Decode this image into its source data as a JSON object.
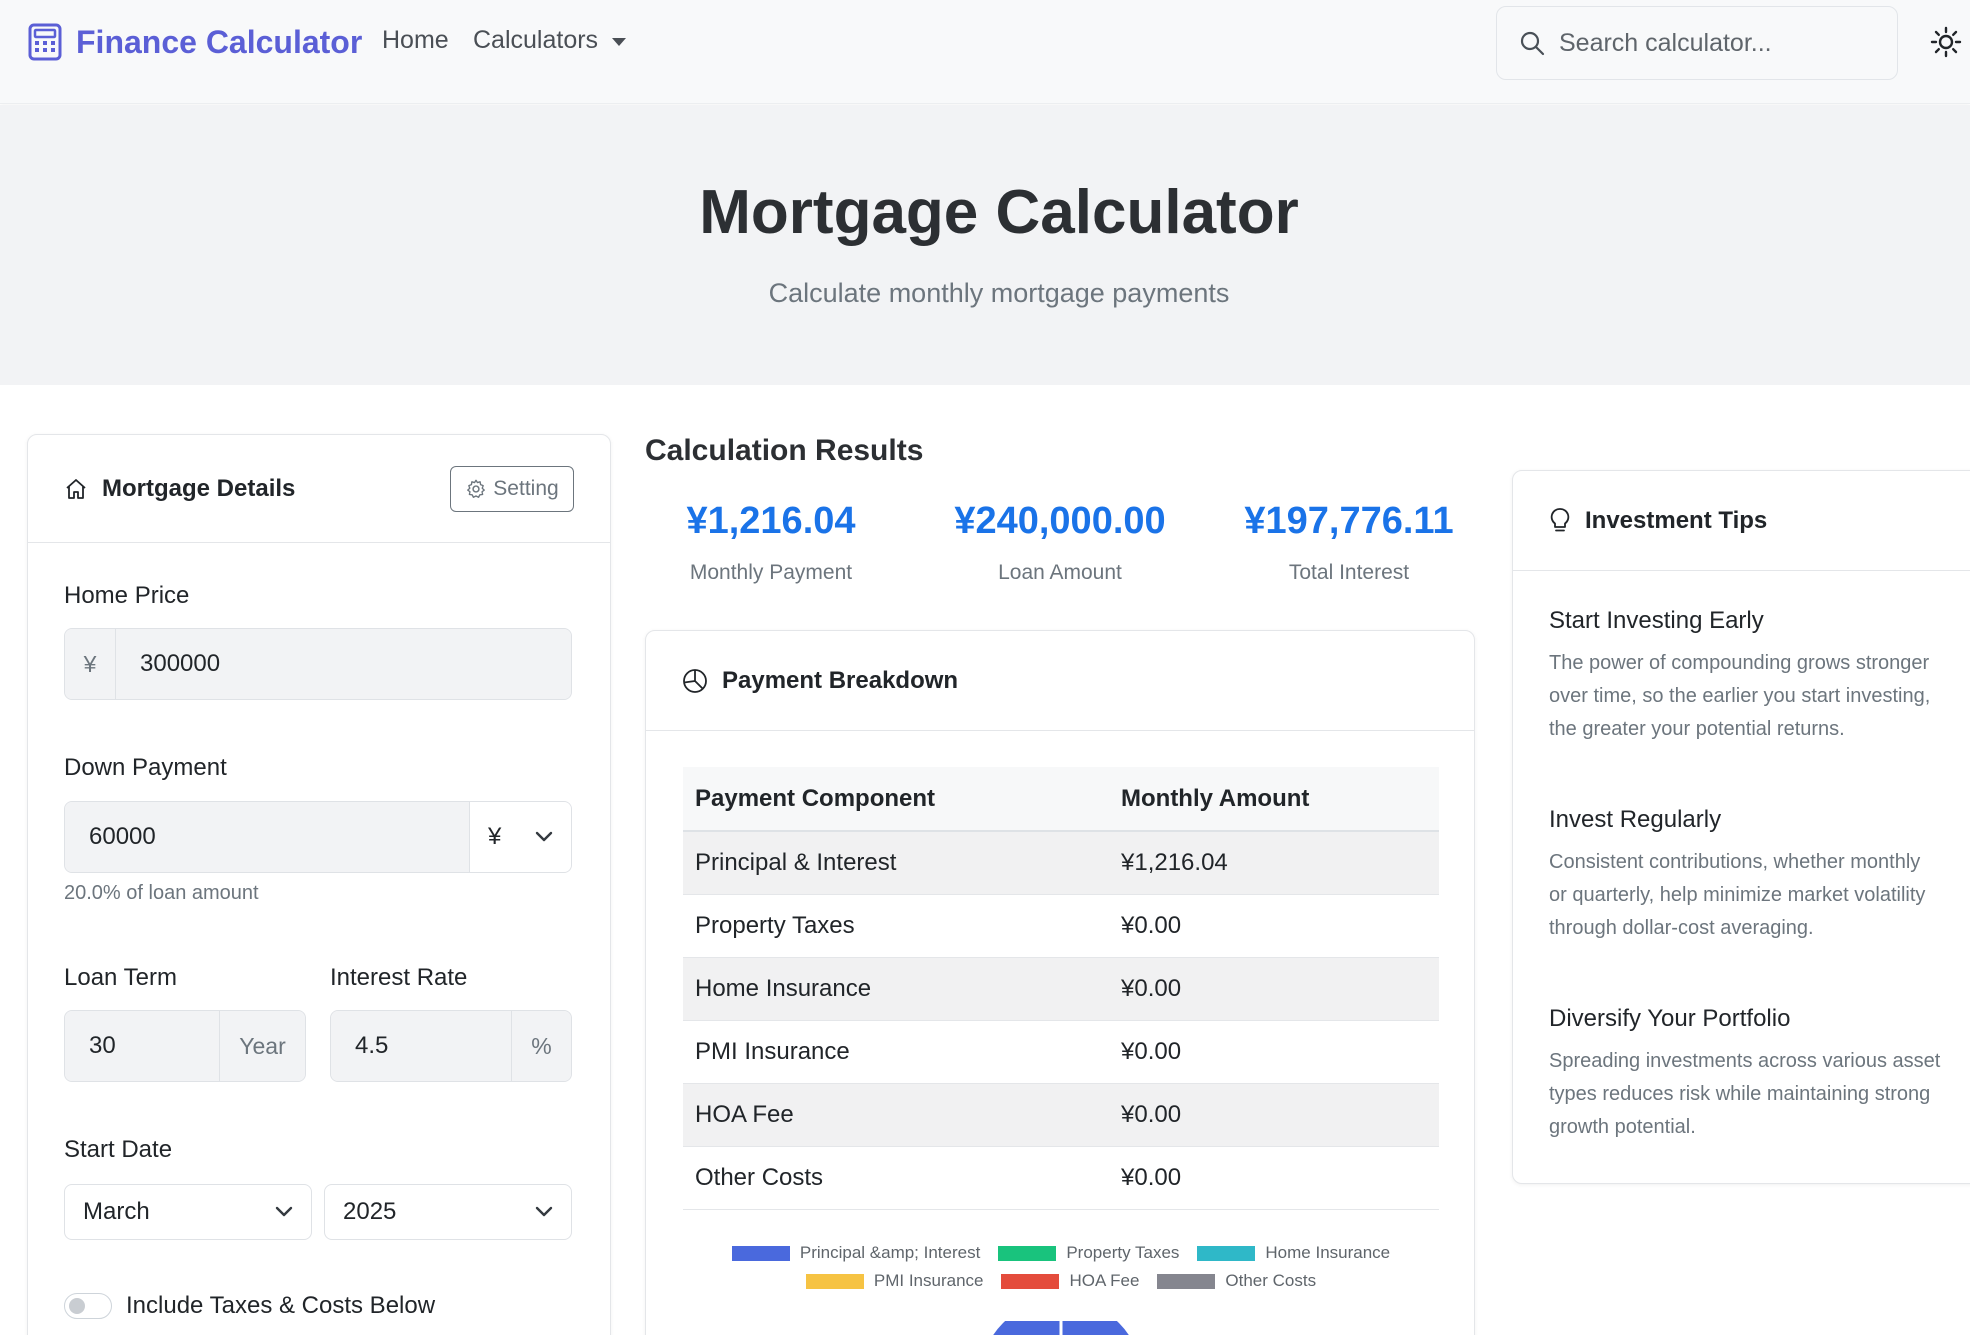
{
  "navbar": {
    "brand": "Finance Calculator",
    "home": "Home",
    "calculators": "Calculators",
    "search_placeholder": "Search calculator..."
  },
  "hero": {
    "title": "Mortgage Calculator",
    "subtitle": "Calculate monthly mortgage payments"
  },
  "details": {
    "title": "Mortgage Details",
    "setting_label": "Setting",
    "home_price": {
      "label": "Home Price",
      "currency": "¥",
      "value": "300000"
    },
    "down_payment": {
      "label": "Down Payment",
      "value": "60000",
      "unit": "¥",
      "helper": "20.0% of loan amount"
    },
    "loan_term": {
      "label": "Loan Term",
      "value": "30",
      "unit": "Year"
    },
    "interest_rate": {
      "label": "Interest Rate",
      "value": "4.5",
      "unit": "%"
    },
    "start_date": {
      "label": "Start Date",
      "month": "March",
      "year": "2025"
    },
    "include_taxes_label": "Include Taxes & Costs Below"
  },
  "results": {
    "title": "Calculation Results",
    "metrics": [
      {
        "value": "¥1,216.04",
        "label": "Monthly Payment"
      },
      {
        "value": "¥240,000.00",
        "label": "Loan Amount"
      },
      {
        "value": "¥197,776.11",
        "label": "Total Interest"
      }
    ]
  },
  "breakdown": {
    "title": "Payment Breakdown",
    "headers": [
      "Payment Component",
      "Monthly Amount"
    ],
    "rows": [
      [
        "Principal & Interest",
        "¥1,216.04"
      ],
      [
        "Property Taxes",
        "¥0.00"
      ],
      [
        "Home Insurance",
        "¥0.00"
      ],
      [
        "PMI Insurance",
        "¥0.00"
      ],
      [
        "HOA Fee",
        "¥0.00"
      ],
      [
        "Other Costs",
        "¥0.00"
      ]
    ],
    "legend": [
      {
        "label": "Principal &amp; Interest",
        "color": "#4a69dd"
      },
      {
        "label": "Property Taxes",
        "color": "#19c37d"
      },
      {
        "label": "Home Insurance",
        "color": "#2fb8c8"
      },
      {
        "label": "PMI Insurance",
        "color": "#f6c343"
      },
      {
        "label": "HOA Fee",
        "color": "#e44c3c"
      },
      {
        "label": "Other Costs",
        "color": "#85868f"
      }
    ]
  },
  "tips": {
    "title": "Investment Tips",
    "items": [
      {
        "title": "Start Investing Early",
        "text": "The power of compounding grows stronger over time, so the earlier you start investing, the greater your potential returns."
      },
      {
        "title": "Invest Regularly",
        "text": "Consistent contributions, whether monthly or quarterly, help minimize market volatility through dollar-cost averaging."
      },
      {
        "title": "Diversify Your Portfolio",
        "text": "Spreading investments across various asset types reduces risk while maintaining strong growth potential."
      }
    ]
  },
  "colors": {
    "brand": "#5b5fd6",
    "accent": "#1a73e8"
  }
}
